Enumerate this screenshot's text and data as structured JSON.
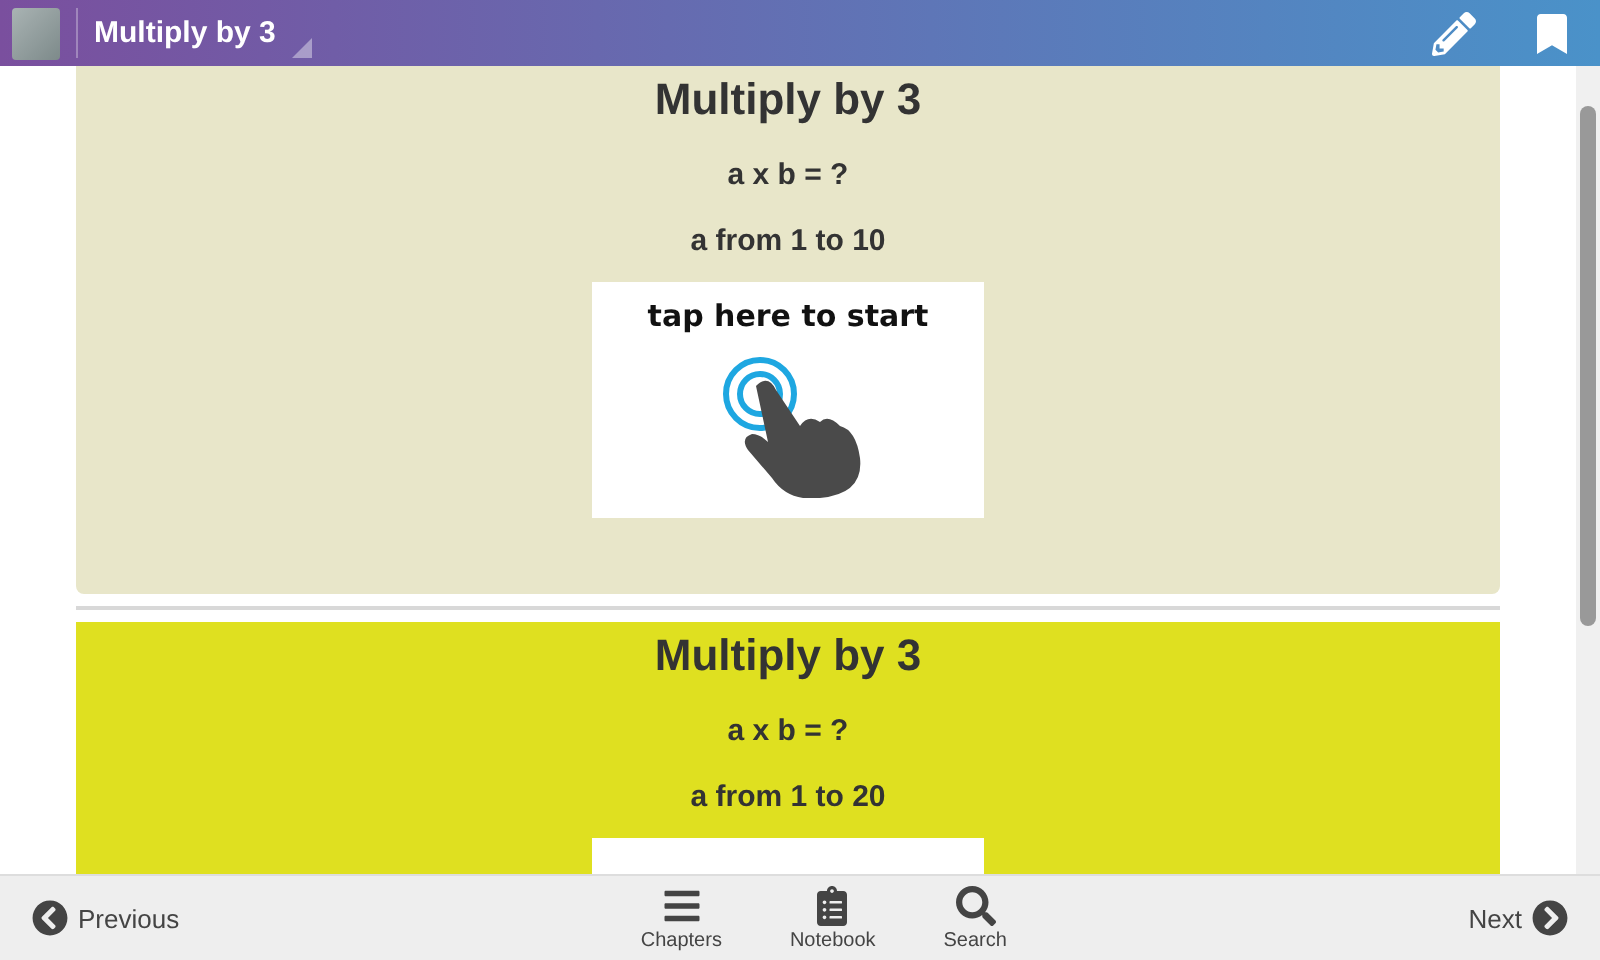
{
  "header": {
    "title": "Multiply by 3"
  },
  "cards": [
    {
      "title": "Multiply by 3",
      "formula": "a x b = ?",
      "range": "a from 1 to 10",
      "color": "#e8e6c9",
      "button_text": "tap here to start"
    },
    {
      "title": "Multiply by 3",
      "formula": "a x b = ?",
      "range": "a from 1 to 20",
      "color": "#dfe020"
    }
  ],
  "footer": {
    "previous": "Previous",
    "next": "Next",
    "tabs": [
      {
        "label": "Chapters",
        "kind": "menu"
      },
      {
        "label": "Notebook",
        "kind": "notebook"
      },
      {
        "label": "Search",
        "kind": "search"
      }
    ]
  }
}
